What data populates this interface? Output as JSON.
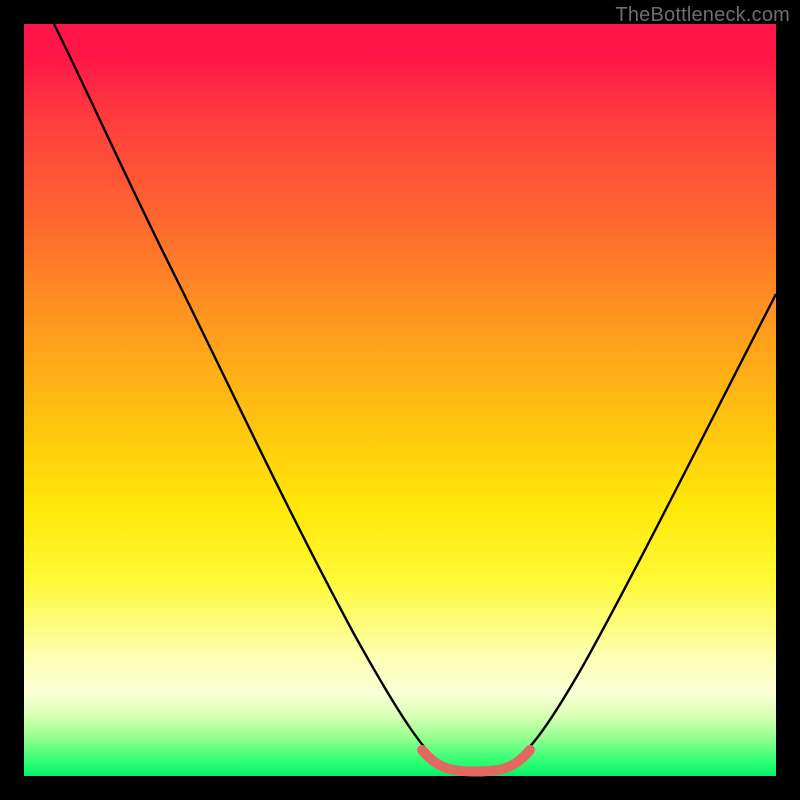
{
  "watermark": "TheBottleneck.com",
  "colors": {
    "frame": "#000000",
    "curve": "#000000",
    "marker": "#e2695f",
    "gradient_stops": [
      "#ff1548",
      "#ff6a2e",
      "#ffe708",
      "#fdffb0",
      "#08f06a"
    ]
  },
  "chart_data": {
    "type": "line",
    "title": "",
    "xlabel": "",
    "ylabel": "",
    "xlim": [
      0,
      100
    ],
    "ylim": [
      0,
      100
    ],
    "grid": false,
    "legend": false,
    "annotations": [],
    "series": [
      {
        "name": "bottleneck-curve",
        "x": [
          4,
          10,
          16,
          22,
          28,
          34,
          40,
          46,
          50,
          54,
          56,
          58,
          60,
          62,
          64,
          66,
          70,
          76,
          82,
          88,
          94,
          100
        ],
        "y": [
          100,
          89,
          78,
          67,
          56,
          45,
          34,
          22,
          13,
          6,
          3,
          1.5,
          1,
          1,
          1.5,
          3,
          8,
          18,
          30,
          42,
          54,
          66
        ]
      }
    ],
    "marker_segment": {
      "name": "trough-highlight",
      "x": [
        54,
        56,
        58,
        60,
        62,
        64,
        66
      ],
      "y": [
        6,
        3,
        1.5,
        1,
        1,
        1.5,
        3
      ]
    }
  }
}
